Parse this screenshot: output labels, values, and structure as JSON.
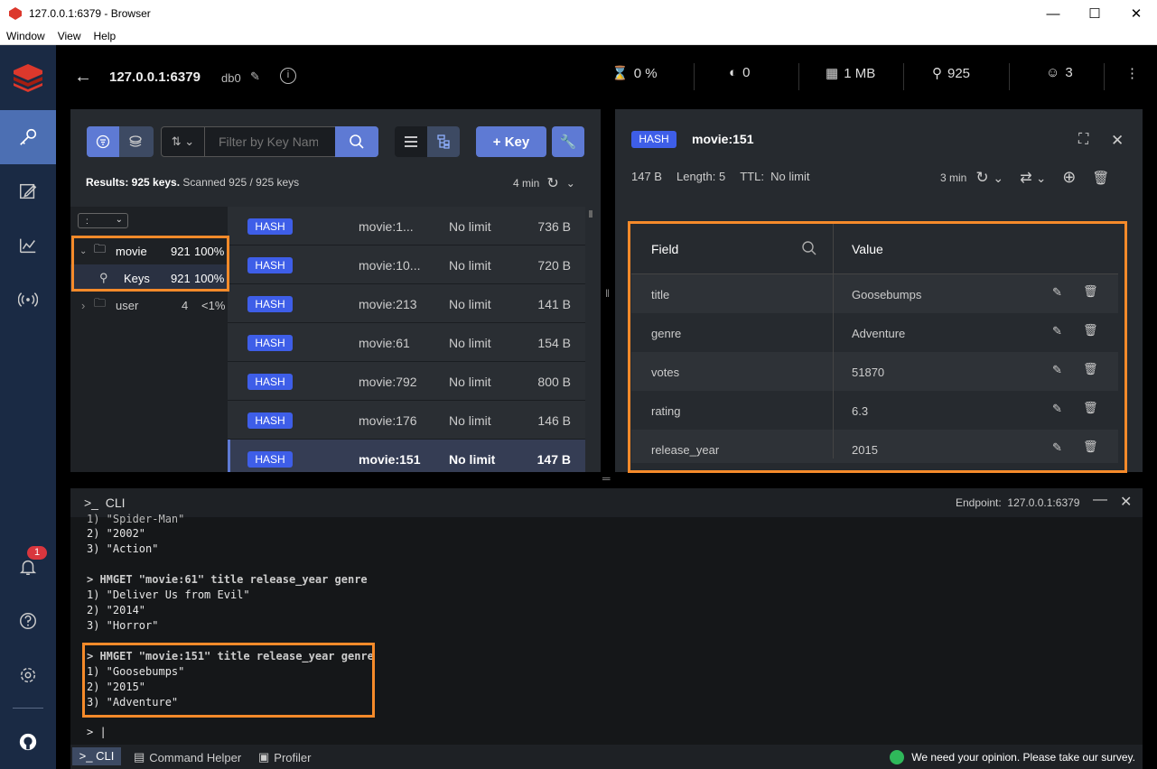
{
  "window": {
    "title": "127.0.0.1:6379 - Browser",
    "menu": [
      "Window",
      "View",
      "Help"
    ]
  },
  "topbar": {
    "host": "127.0.0.1:6379",
    "db": "db0",
    "stats": [
      {
        "icon": "cpu-icon",
        "value": "0 %"
      },
      {
        "icon": "gauge-icon",
        "value": "0"
      },
      {
        "icon": "memory-icon",
        "value": "1 MB"
      },
      {
        "icon": "key-icon",
        "value": "925"
      },
      {
        "icon": "users-icon",
        "value": "3"
      }
    ]
  },
  "sidebar": {
    "notification_count": "1"
  },
  "browser": {
    "search_placeholder": "Filter by Key Name or Pattern",
    "add_key": "+ Key",
    "results_bold": "Results: 925 keys.",
    "results_rest": " Scanned 925 / 925 keys",
    "refresh_time": "4 min",
    "delimiter": ":",
    "tree": [
      {
        "name": "movie",
        "count": "921",
        "percent": "100%"
      },
      {
        "name": "Keys",
        "count": "921",
        "percent": "100%"
      },
      {
        "name": "user",
        "count": "4",
        "percent": "<1%"
      }
    ],
    "keys": [
      {
        "type": "HASH",
        "name": "movie:1...",
        "ttl": "No limit",
        "size": "736 B"
      },
      {
        "type": "HASH",
        "name": "movie:10...",
        "ttl": "No limit",
        "size": "720 B"
      },
      {
        "type": "HASH",
        "name": "movie:213",
        "ttl": "No limit",
        "size": "141 B"
      },
      {
        "type": "HASH",
        "name": "movie:61",
        "ttl": "No limit",
        "size": "154 B"
      },
      {
        "type": "HASH",
        "name": "movie:792",
        "ttl": "No limit",
        "size": "800 B"
      },
      {
        "type": "HASH",
        "name": "movie:176",
        "ttl": "No limit",
        "size": "146 B"
      },
      {
        "type": "HASH",
        "name": "movie:151",
        "ttl": "No limit",
        "size": "147 B"
      }
    ]
  },
  "details": {
    "type": "HASH",
    "name": "movie:151",
    "size": "147 B",
    "length": "Length: 5",
    "ttl_label": "TTL:",
    "ttl_value": "No limit",
    "refresh_time": "3 min",
    "col_field": "Field",
    "col_value": "Value",
    "fields": [
      {
        "field": "title",
        "value": "Goosebumps"
      },
      {
        "field": "genre",
        "value": "Adventure"
      },
      {
        "field": "votes",
        "value": "51870"
      },
      {
        "field": "rating",
        "value": "6.3"
      },
      {
        "field": "release_year",
        "value": "2015"
      }
    ]
  },
  "cli": {
    "title": "CLI",
    "endpoint_label": "Endpoint:",
    "endpoint": "127.0.0.1:6379",
    "lines": [
      "1) \"Spider-Man\"",
      "2) \"2002\"",
      "3) \"Action\"",
      "",
      "> HMGET \"movie:61\" title release_year genre",
      "1) \"Deliver Us from Evil\"",
      "2) \"2014\"",
      "3) \"Horror\"",
      "",
      "> HMGET \"movie:151\" title release_year genre",
      "1) \"Goosebumps\"",
      "2) \"2015\"",
      "3) \"Adventure\"",
      "",
      "> |"
    ]
  },
  "bottombar": {
    "cli": ">_ CLI",
    "helper": "Command Helper",
    "profiler": "Profiler",
    "survey": "We need your opinion. Please take our survey."
  },
  "colors": {
    "accent": "#5e7ad4",
    "hash_tag": "#3e5ee8",
    "highlight": "#f58a2a",
    "sidebar": "#1a2a44"
  }
}
